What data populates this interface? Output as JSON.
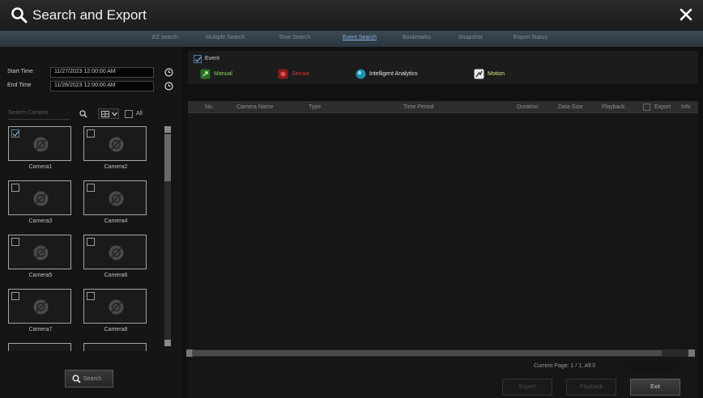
{
  "window": {
    "title": "Search and Export"
  },
  "tabs": [
    {
      "label": "EZ search"
    },
    {
      "label": "Multiple Search"
    },
    {
      "label": "Time Search"
    },
    {
      "label": "Event Search"
    },
    {
      "label": "Bookmarks"
    },
    {
      "label": "Snapshot"
    },
    {
      "label": "Export Status"
    }
  ],
  "active_tab": "Event Search",
  "filters": {
    "start_time_label": "Start Time",
    "start_time_value": "11/27/2023 12:00:00 AM",
    "end_time_label": "End Time",
    "end_time_value": "11/28/2023 12:00:00 AM",
    "camera_search_placeholder": "Search Camera",
    "all_label": "All"
  },
  "cameras": [
    {
      "name": "Camera1",
      "checked": true
    },
    {
      "name": "Camera2",
      "checked": false
    },
    {
      "name": "Camera3",
      "checked": false
    },
    {
      "name": "Camera4",
      "checked": false
    },
    {
      "name": "Camera5",
      "checked": false
    },
    {
      "name": "Camera6",
      "checked": false
    },
    {
      "name": "Camera7",
      "checked": false
    },
    {
      "name": "Camera8",
      "checked": false
    }
  ],
  "left_actions": {
    "search_label": "Search"
  },
  "event_filter": {
    "event_label": "Event",
    "event_checked": true,
    "types": [
      {
        "label": "Manual",
        "color": "#8ad15a",
        "icon": "manual-icon"
      },
      {
        "label": "Sensor",
        "color": "#d23a3a",
        "icon": "sensor-icon"
      },
      {
        "label": "Intelligent Analytics",
        "color": "#e8e8e8",
        "icon": "intelligent-analytics-icon"
      },
      {
        "label": "Motion",
        "color": "#e6e07a",
        "icon": "motion-icon"
      }
    ]
  },
  "table": {
    "columns": [
      "No.",
      "Camera Name",
      "Type",
      "Time Period",
      "Duration",
      "Data Size",
      "Playback",
      "Export",
      "Info"
    ],
    "rows": []
  },
  "pagination": {
    "text": "Current Page: 1 / 1, All:0"
  },
  "bottom_actions": {
    "export_label": "Export",
    "playback_label": "Playback",
    "exit_label": "Exit"
  },
  "colors": {
    "accent": "#86aee0",
    "background": "#111111",
    "titlebar": "#1f1f1f"
  }
}
